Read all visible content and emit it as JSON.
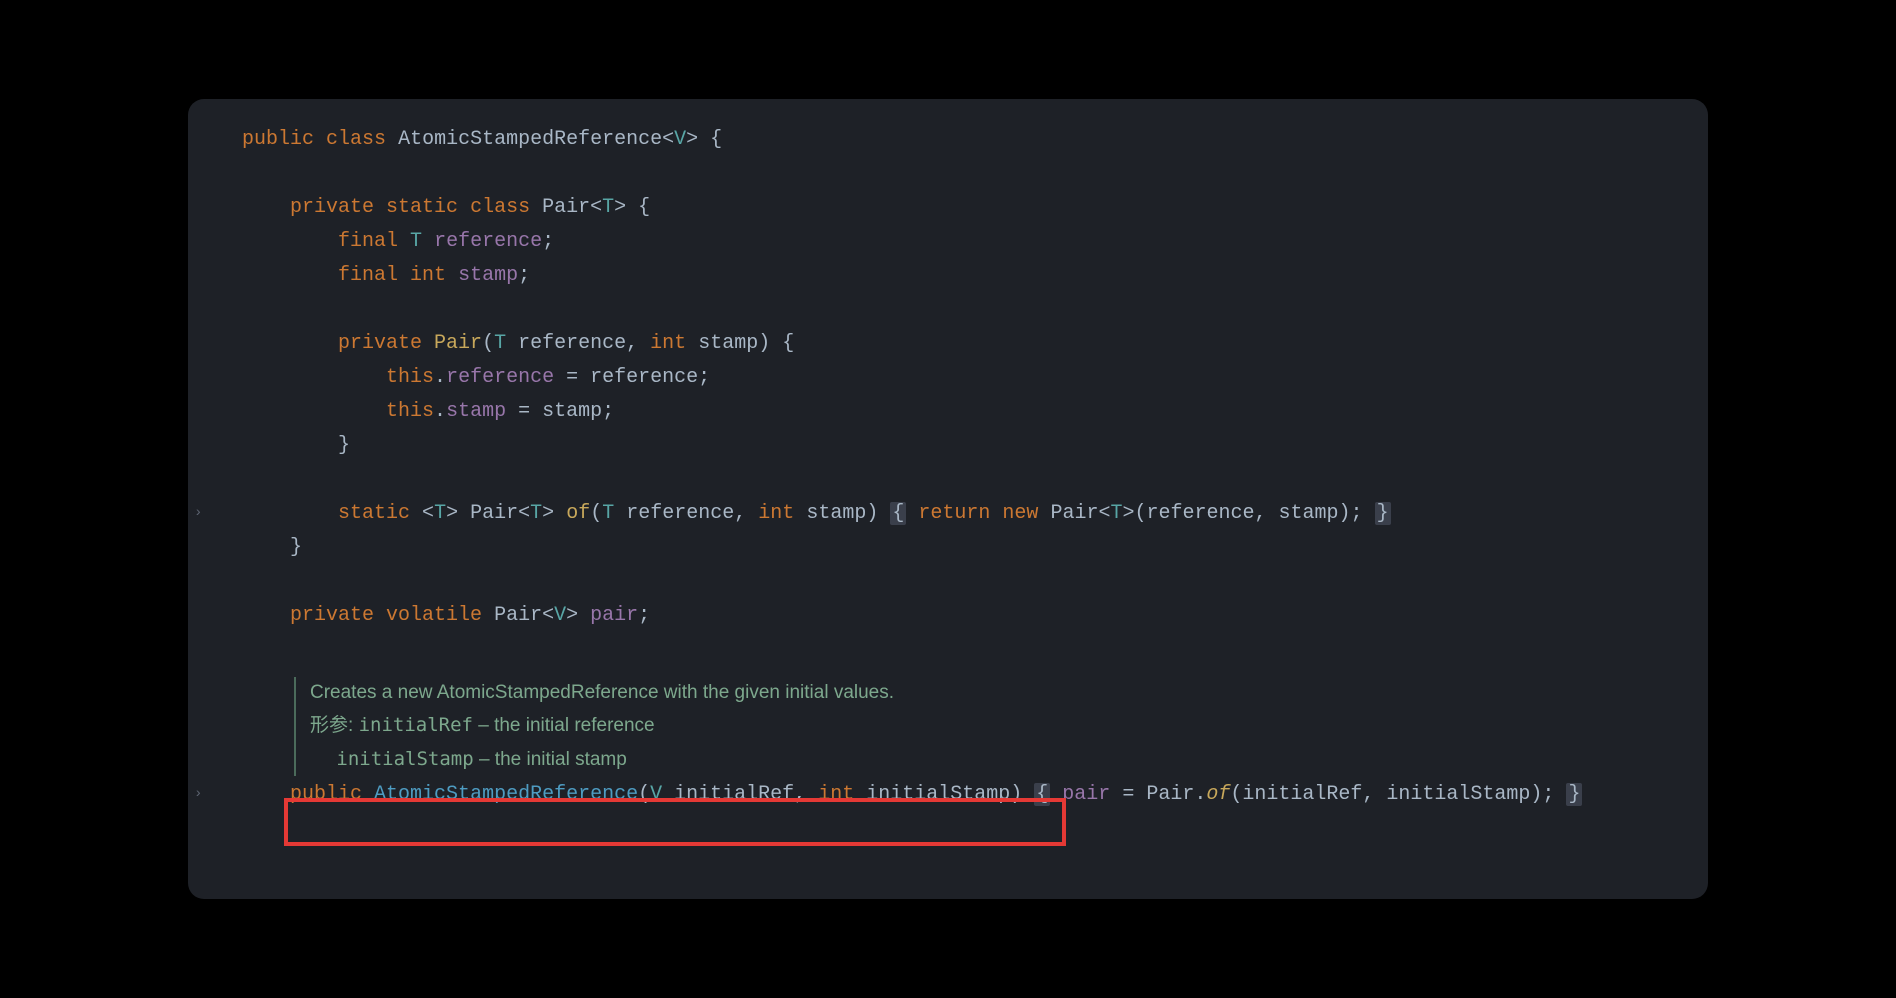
{
  "code": {
    "l1": {
      "public": "public",
      "class": "class",
      "name": "AtomicStampedReference",
      "lt": "<",
      "gen": "V",
      "gt": ">",
      "brace": " {"
    },
    "l2": {
      "private": "private",
      "static": "static",
      "class": "class",
      "name": "Pair",
      "lt": "<",
      "gen": "T",
      "gt": ">",
      "brace": " {"
    },
    "l3": {
      "final": "final",
      "type": "T",
      "field": "reference",
      "semi": ";"
    },
    "l4": {
      "final": "final",
      "type": "int",
      "field": "stamp",
      "semi": ";"
    },
    "l5": {
      "private": "private",
      "name": "Pair",
      "lp": "(",
      "p1t": "T",
      "p1n": "reference",
      "comma": ", ",
      "p2t": "int",
      "p2n": "stamp",
      "rp": ")",
      "brace": " {"
    },
    "l6": {
      "this": "this",
      "dot": ".",
      "fld": "reference",
      "eq": " = ",
      "rhs": "reference",
      "semi": ";"
    },
    "l7": {
      "this": "this",
      "dot": ".",
      "fld": "stamp",
      "eq": " = ",
      "rhs": "stamp",
      "semi": ";"
    },
    "l8": {
      "brace": "}"
    },
    "l9": {
      "static": "static",
      "lt": "<",
      "gen": "T",
      "gt": ">",
      "ret": "Pair",
      "rlt": "<",
      "rgen": "T",
      "rgt": ">",
      "meth": "of",
      "lp": "(",
      "p1t": "T",
      "p1n": "reference",
      "comma": ", ",
      "p2t": "int",
      "p2n": "stamp",
      "rp": ") ",
      "foldL": "{",
      "return": "return",
      "new": "new",
      "ctor": "Pair",
      "clt": "<",
      "cgen": "T",
      "cgt": ">",
      "args": "(reference, stamp); ",
      "foldR": "}"
    },
    "l10": {
      "brace": "}"
    },
    "l11": {
      "private": "private",
      "volatile": "volatile",
      "type": "Pair",
      "lt": "<",
      "gen": "V",
      "gt": ">",
      "field": "pair",
      "semi": ";"
    },
    "l12": {
      "public": "public",
      "ctor": "AtomicStampedReference",
      "lp": "(",
      "p1t": "V",
      "p1n": "initialRef",
      "comma": ", ",
      "p2t": "int",
      "p2n": "initialStamp",
      "rp": ") ",
      "foldL": "{",
      "body_lhs": "pair",
      "eq": " = ",
      "cls": "Pair",
      "dot": ".",
      "m": "of",
      "args": "(initialRef, initialStamp); ",
      "foldR": "}"
    }
  },
  "doc": {
    "summary": "Creates a new AtomicStampedReference with the given initial values.",
    "params_label": "形参:",
    "p1_name": "initialRef",
    "p1_desc": " – the initial reference",
    "p2_name": "initialStamp",
    "p2_desc": " – the initial stamp"
  },
  "gutter": {
    "chev1": "›",
    "chev2": "›"
  }
}
